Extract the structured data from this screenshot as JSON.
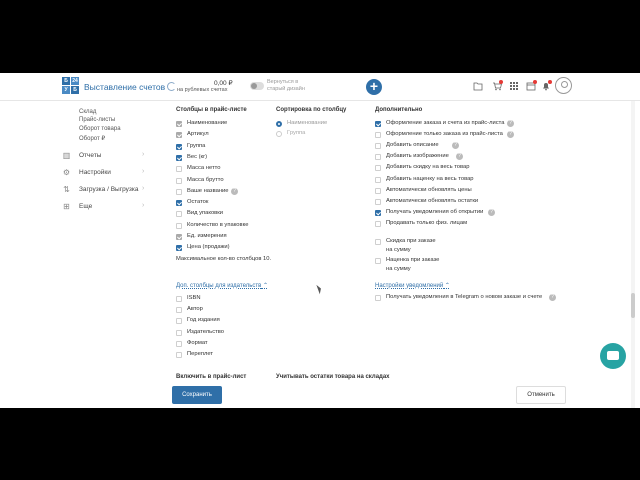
{
  "header": {
    "logo_text": [
      "Б",
      "24",
      "У",
      "Б"
    ],
    "app_title": "Выставление счетов",
    "balance_amount": "0,00 ₽",
    "balance_label": "на рублевых счетах",
    "old_design_label": "Вернуться в старый дизайн",
    "plus_label": "+",
    "icons": [
      "folder-icon",
      "cart-icon",
      "apps-grid-icon",
      "calendar-icon",
      "bell-icon",
      "user-icon"
    ],
    "brand_color": "#2f6fa8"
  },
  "sidebar": {
    "sub_items": [
      "Склад",
      "Прайс-листы",
      "Оборот товара",
      "Оборот ₽"
    ],
    "items": [
      {
        "label": "Отчеты",
        "icon": "reports-icon"
      },
      {
        "label": "Настройки",
        "icon": "settings-icon"
      },
      {
        "label": "Загрузка / Выгрузка",
        "icon": "upload-download-icon"
      },
      {
        "label": "Еще",
        "icon": "more-icon"
      }
    ]
  },
  "columns_section": {
    "title": "Столбцы в прайс-листе",
    "items": [
      {
        "label": "Наименование",
        "state": "disabled-checked"
      },
      {
        "label": "Артикул",
        "state": "disabled-checked"
      },
      {
        "label": "Группа",
        "state": "checked"
      },
      {
        "label": "Вес (кг)",
        "state": "checked"
      },
      {
        "label": "Масса нетто",
        "state": "unchecked"
      },
      {
        "label": "Масса брутто",
        "state": "unchecked"
      },
      {
        "label": "Ваше название",
        "state": "unchecked",
        "help": true
      },
      {
        "label": "Остаток",
        "state": "checked"
      },
      {
        "label": "Вид упаковки",
        "state": "unchecked"
      },
      {
        "label": "Количество в упаковке",
        "state": "unchecked"
      },
      {
        "label": "Ед. измерения",
        "state": "disabled-checked"
      },
      {
        "label": "Цена (продажи)",
        "state": "checked"
      }
    ],
    "max_note": "Максимальное кол-во столбцов 10."
  },
  "sort_section": {
    "title": "Сортировка по столбцу",
    "options": [
      {
        "label": "Наименование",
        "selected": true
      },
      {
        "label": "Группа",
        "selected": false
      }
    ]
  },
  "extra_section": {
    "title": "Дополнительно",
    "items": [
      {
        "label": "Оформление заказа и счета из прайс-листа",
        "state": "checked",
        "help": true
      },
      {
        "label": "Оформление только заказа из прайс-листа",
        "state": "unchecked",
        "help": true
      },
      {
        "label": "Добавить описание",
        "state": "unchecked",
        "help": true
      },
      {
        "label": "Добавить изображение",
        "state": "unchecked",
        "help": true
      },
      {
        "label": "Добавить скидку на весь товар",
        "state": "unchecked",
        "help": false
      },
      {
        "label": "Добавить наценку на весь товар",
        "state": "unchecked",
        "help": false
      },
      {
        "label": "Автоматически обновлять цены",
        "state": "unchecked",
        "help": false
      },
      {
        "label": "Автоматически обновлять остатки",
        "state": "unchecked",
        "help": false
      },
      {
        "label": "Получать уведомления об открытии",
        "state": "checked",
        "help": true
      },
      {
        "label": "Продавать только физ. лицам",
        "state": "unchecked",
        "help": false
      }
    ],
    "discount_label": [
      "Скидка при заказе",
      "на сумму"
    ],
    "markup_label": [
      "Наценка при заказе",
      "на сумму"
    ]
  },
  "publisher_section": {
    "link": "Доп. столбцы для издательств",
    "items": [
      "ISBN",
      "Автор",
      "Год издания",
      "Издательство",
      "Формат",
      "Переплет"
    ]
  },
  "notify_section": {
    "link": "Настройки уведомлений",
    "item": "Получать уведомления в Telegram о новом заказе и счете"
  },
  "footer": {
    "include_label": "Включить в прайс-лист",
    "stock_label": "Учитывать остатки товара на складах",
    "save_label": "Сохранить",
    "cancel_label": "Отменить"
  }
}
